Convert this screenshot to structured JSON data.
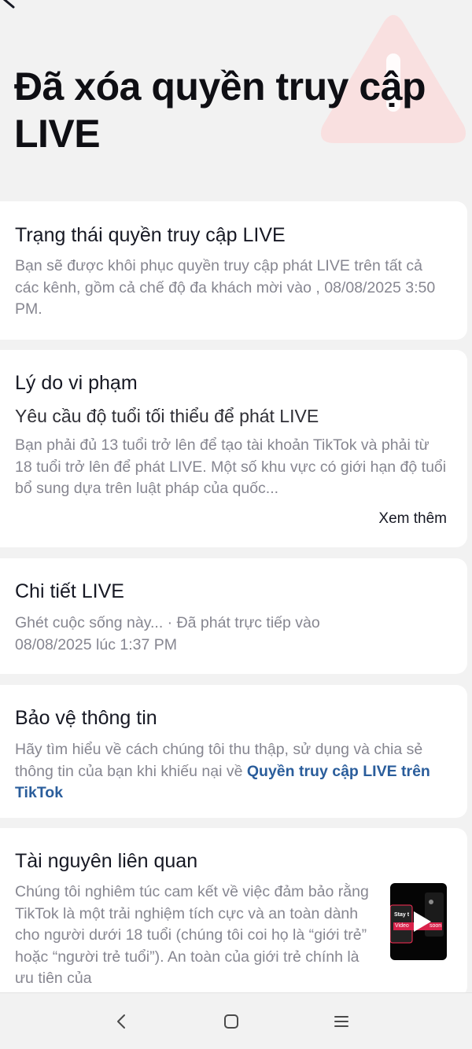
{
  "header": {
    "title": "Đã xóa quyền truy cập LIVE",
    "back_icon": "chevron-left-icon",
    "illustration_icon": "warning-triangle-icon"
  },
  "colors": {
    "background": "#f2f2f2",
    "card": "#ffffff",
    "link": "#2a5d9b",
    "warning_tint": "#f7d6d6"
  },
  "cards": {
    "status": {
      "title": "Trạng thái quyền truy cập LIVE",
      "body": "Bạn sẽ được khôi phục quyền truy cập phát LIVE trên tất cả các kênh, gồm cả chế độ đa khách mời vào , 08/08/2025 3:50 PM."
    },
    "violation": {
      "title": "Lý do vi phạm",
      "subtitle": "Yêu cầu độ tuổi tối thiểu để phát LIVE",
      "body": "Bạn phải đủ 13 tuổi trở lên để tạo tài khoản TikTok và phải từ 18 tuổi trở lên để phát LIVE. Một số khu vực có giới hạn độ tuổi bổ sung dựa trên luật pháp của quốc...",
      "more_label": "Xem thêm"
    },
    "live_details": {
      "title": "Chi tiết LIVE",
      "body": "Ghét cuộc sống này... · Đã phát trực tiếp vào 08/08/2025 lúc 1:37 PM"
    },
    "privacy": {
      "title": "Bảo vệ thông tin",
      "body": "Hãy tìm hiểu về cách chúng tôi thu thập, sử dụng và chia sẻ thông tin của bạn khi khiếu nại về ",
      "link": "Quyền truy cập LIVE trên TikTok"
    },
    "resources": {
      "title": "Tài nguyên liên quan",
      "body": "Chúng tôi nghiêm túc cam kết về việc đảm bảo rằng TikTok là một trải nghiệm tích cực và an toàn dành cho người dưới 18 tuổi (chúng tôi coi họ là “giới trẻ” hoặc “người trẻ tuổi”). An toàn của giới trẻ chính là ưu tiên của",
      "thumb_text_1": "Stay t",
      "thumb_text_2": "Video",
      "thumb_text_3": "soon",
      "thumb_icon": "play-icon"
    }
  },
  "navbar": {
    "back_icon": "nav-back-icon",
    "home_icon": "nav-home-icon",
    "menu_icon": "nav-menu-icon"
  }
}
